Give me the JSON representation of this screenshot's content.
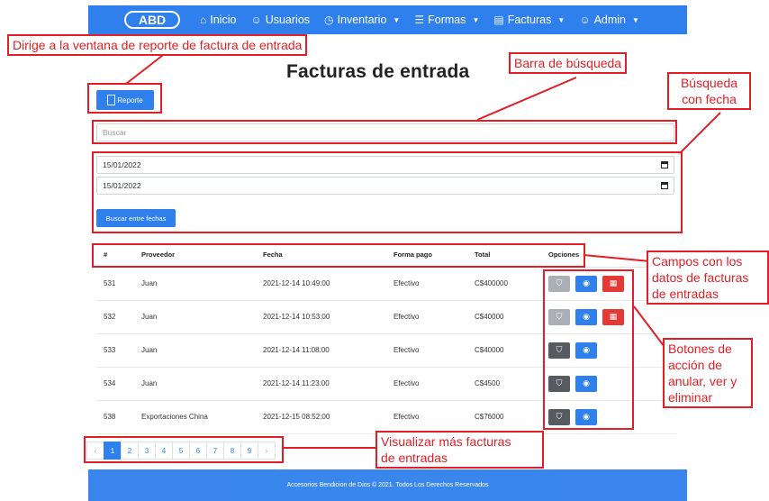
{
  "navbar": {
    "logo": "ABD",
    "items": [
      {
        "icon": "home-icon",
        "label": "Inicio",
        "dropdown": false
      },
      {
        "icon": "users-icon",
        "label": "Usuarios",
        "dropdown": false
      },
      {
        "icon": "clock-icon",
        "label": "Inventario",
        "dropdown": true
      },
      {
        "icon": "sliders-icon",
        "label": "Formas",
        "dropdown": true
      },
      {
        "icon": "receipt-icon",
        "label": "Facturas",
        "dropdown": true
      },
      {
        "icon": "admin-user-icon",
        "label": "Admin",
        "dropdown": true
      }
    ]
  },
  "page_title": "Facturas de entrada",
  "report_button": "Reporte",
  "search": {
    "placeholder": "Buscar"
  },
  "dates": {
    "from": "15/01/2022",
    "to": "15/01/2022"
  },
  "date_search_button": "Buscar entre fechas",
  "table": {
    "headers": [
      "#",
      "Proveedor",
      "Fecha",
      "Forma pago",
      "Total",
      "Opciones"
    ],
    "rows": [
      {
        "id": "531",
        "proveedor": "Juan",
        "fecha": "2021-12-14 10:49:00",
        "forma": "Efectivo",
        "total": "C$400000",
        "annul_disabled": true,
        "delete": true
      },
      {
        "id": "532",
        "proveedor": "Juan",
        "fecha": "2021-12-14 10:53:00",
        "forma": "Efectivo",
        "total": "C$40000",
        "annul_disabled": true,
        "delete": true
      },
      {
        "id": "533",
        "proveedor": "Juan",
        "fecha": "2021-12-14 11:08:00",
        "forma": "Efectivo",
        "total": "C$40000",
        "annul_disabled": false,
        "delete": false
      },
      {
        "id": "534",
        "proveedor": "Juan",
        "fecha": "2021-12-14 11:23:00",
        "forma": "Efectivo",
        "total": "C$4500",
        "annul_disabled": false,
        "delete": false
      },
      {
        "id": "538",
        "proveedor": "Exportaciones China",
        "fecha": "2021-12-15 08:52:00",
        "forma": "Efectivo",
        "total": "C$76000",
        "annul_disabled": false,
        "delete": false
      }
    ]
  },
  "pagination": {
    "prev": "‹",
    "pages": [
      "1",
      "2",
      "3",
      "4",
      "5",
      "6",
      "7",
      "8",
      "9"
    ],
    "active": "1",
    "next": "›"
  },
  "footer": "Accesorios Bendicion de Dios © 2021. Todos Los Derechos Reservados",
  "annotations": {
    "report": "Dirige a la ventana de reporte de factura de entrada",
    "search": "Barra de búsqueda",
    "date_search": [
      "Búsqueda",
      "con fecha"
    ],
    "fields": [
      "Campos con los",
      "datos de facturas",
      "de entradas"
    ],
    "actions": [
      "Botones de",
      "acción de",
      "anular, ver y",
      "eliminar"
    ],
    "pagination": [
      "Visualizar más facturas",
      "de entradas"
    ]
  },
  "colors": {
    "primary": "#2f80ed",
    "danger": "#e53935",
    "annotation": "#e41e26"
  }
}
